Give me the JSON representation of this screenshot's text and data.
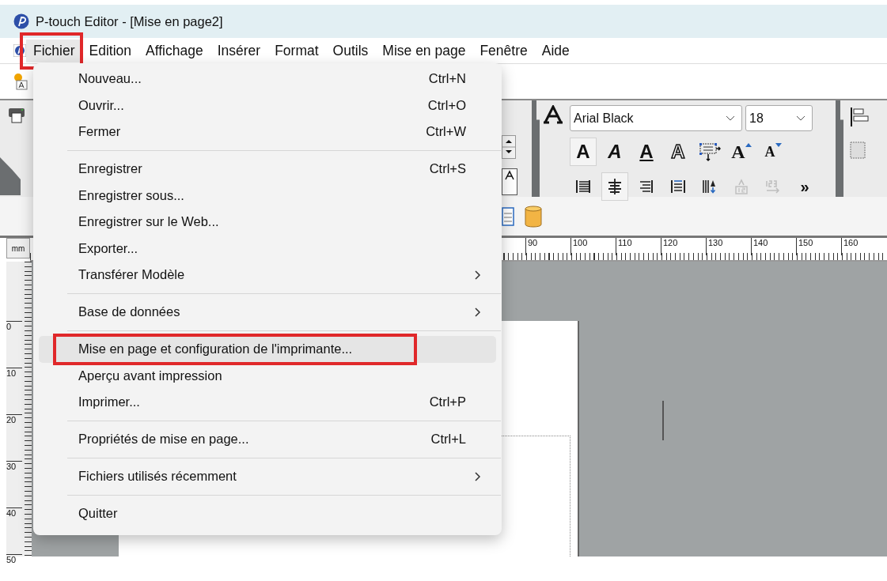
{
  "window": {
    "title": "P-touch Editor - [Mise en page2]"
  },
  "menubar": [
    {
      "label": "Fichier",
      "selected": true,
      "annotated": true
    },
    {
      "label": "Edition",
      "selected": false,
      "annotated": false
    },
    {
      "label": "Affichage",
      "selected": false,
      "annotated": false
    },
    {
      "label": "Insérer",
      "selected": false,
      "annotated": false
    },
    {
      "label": "Format",
      "selected": false,
      "annotated": false
    },
    {
      "label": "Outils",
      "selected": false,
      "annotated": false
    },
    {
      "label": "Mise en page",
      "selected": false,
      "annotated": false
    },
    {
      "label": "Fenêtre",
      "selected": false,
      "annotated": false
    },
    {
      "label": "Aide",
      "selected": false,
      "annotated": false
    }
  ],
  "file_menu": [
    {
      "kind": "item",
      "label": "Nouveau...",
      "shortcut": "Ctrl+N",
      "submenu": false,
      "selected": false,
      "annotated": false
    },
    {
      "kind": "item",
      "label": "Ouvrir...",
      "shortcut": "Ctrl+O",
      "submenu": false,
      "selected": false,
      "annotated": false
    },
    {
      "kind": "item",
      "label": "Fermer",
      "shortcut": "Ctrl+W",
      "submenu": false,
      "selected": false,
      "annotated": false
    },
    {
      "kind": "separator"
    },
    {
      "kind": "item",
      "label": "Enregistrer",
      "shortcut": "Ctrl+S",
      "submenu": false,
      "selected": false,
      "annotated": false
    },
    {
      "kind": "item",
      "label": "Enregistrer sous...",
      "submenu": false,
      "selected": false,
      "annotated": false
    },
    {
      "kind": "item",
      "label": "Enregistrer sur le Web...",
      "submenu": false,
      "selected": false,
      "annotated": false
    },
    {
      "kind": "item",
      "label": "Exporter...",
      "submenu": false,
      "selected": false,
      "annotated": false
    },
    {
      "kind": "item",
      "label": "Transférer Modèle",
      "submenu": true,
      "selected": false,
      "annotated": false
    },
    {
      "kind": "separator"
    },
    {
      "kind": "item",
      "label": "Base de données",
      "submenu": true,
      "selected": false,
      "annotated": false
    },
    {
      "kind": "separator"
    },
    {
      "kind": "item",
      "label": "Mise en page et configuration de l'imprimante...",
      "submenu": false,
      "selected": true,
      "annotated": true
    },
    {
      "kind": "item",
      "label": "Aperçu avant impression",
      "submenu": false,
      "selected": false,
      "annotated": false
    },
    {
      "kind": "item",
      "label": "Imprimer...",
      "shortcut": "Ctrl+P",
      "submenu": false,
      "selected": false,
      "annotated": false
    },
    {
      "kind": "separator"
    },
    {
      "kind": "item",
      "label": "Propriétés de mise en page...",
      "shortcut": "Ctrl+L",
      "submenu": false,
      "selected": false,
      "annotated": false
    },
    {
      "kind": "separator"
    },
    {
      "kind": "item",
      "label": "Fichiers utilisés récemment",
      "submenu": true,
      "selected": false,
      "annotated": false
    },
    {
      "kind": "separator"
    },
    {
      "kind": "item",
      "label": "Quitter",
      "submenu": false,
      "selected": false,
      "annotated": false
    }
  ],
  "font_toolbar": {
    "font": "Arial Black",
    "size": "18",
    "style_buttons": [
      {
        "kind": "bold",
        "glyph": "A",
        "selected": true
      },
      {
        "kind": "italic",
        "glyph": "A",
        "selected": false
      },
      {
        "kind": "underline",
        "glyph": "A",
        "selected": false
      },
      {
        "kind": "outline",
        "glyph": "A",
        "selected": false
      },
      {
        "kind": "frame",
        "selected": false
      },
      {
        "kind": "grow",
        "glyph": "A",
        "selected": false
      },
      {
        "kind": "shrink",
        "glyph": "A",
        "selected": false
      }
    ],
    "align_buttons": [
      {
        "kind": "left",
        "selected": false,
        "disabled": false
      },
      {
        "kind": "center",
        "selected": true,
        "disabled": false
      },
      {
        "kind": "right",
        "selected": false,
        "disabled": false
      },
      {
        "kind": "justify",
        "selected": false,
        "disabled": false
      },
      {
        "kind": "vertical",
        "selected": false,
        "disabled": false
      },
      {
        "kind": "number-a",
        "selected": false,
        "disabled": true
      },
      {
        "kind": "number-123",
        "selected": false,
        "disabled": true
      }
    ],
    "more": "»"
  },
  "ruler": {
    "unit": "mm",
    "horizontal_labels": [
      "90",
      "100",
      "110",
      "120",
      "130",
      "140",
      "150",
      "160"
    ],
    "vertical_labels": [
      "0",
      "10",
      "20",
      "30",
      "40",
      "50"
    ]
  }
}
